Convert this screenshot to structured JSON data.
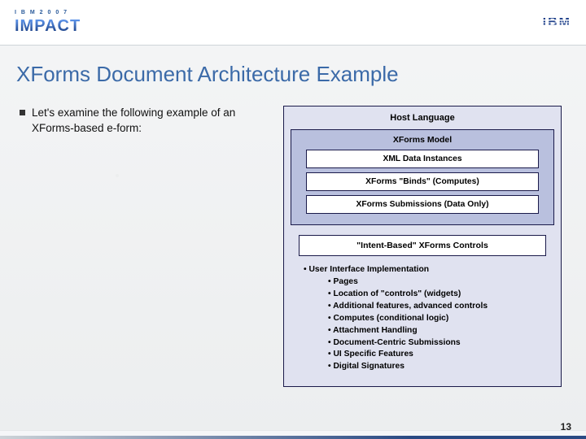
{
  "header": {
    "brand_top": "I B M  2 0 0 7",
    "brand_main": "IMPACT",
    "ibm": "IBM"
  },
  "title": "XForms Document Architecture Example",
  "left_bullet": "Let's examine the following example of an XForms-based e-form:",
  "diagram": {
    "host_label": "Host Language",
    "model_label": "XForms Model",
    "model_items": [
      "XML Data Instances",
      "XForms \"Binds\" (Computes)",
      "XForms Submissions (Data Only)"
    ],
    "controls_label": "\"Intent-Based\" XForms Controls",
    "impl_head": "User Interface Implementation",
    "impl_items": [
      "Pages",
      "Location of \"controls\" (widgets)",
      "Additional features, advanced controls",
      "Computes (conditional logic)",
      "Attachment Handling",
      "Document-Centric Submissions",
      "UI Specific Features",
      "Digital Signatures"
    ]
  },
  "page_number": "13"
}
